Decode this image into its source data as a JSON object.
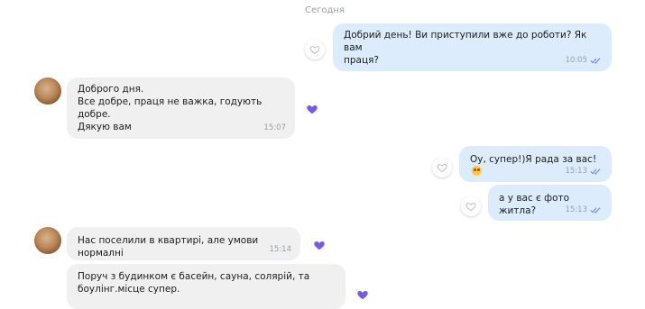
{
  "chat": {
    "date_separator": "Сегодня",
    "messages": [
      {
        "text": "Добрий день! Ви приступили вже до роботи? Як вам\nпраця?",
        "time": "10:05"
      },
      {
        "text": "Доброго дня.\nВсе добре,  праця не важка, годують добре.\nДякую вам",
        "time": "15:07"
      },
      {
        "text": "Оу, супер!)Я рада за вас!",
        "time": "15:13"
      },
      {
        "text": "а у вас є фото житла?",
        "time": "15:13"
      },
      {
        "text": "Нас поселили в квартирі, але умови нормалні",
        "time": "15:14"
      },
      {
        "text": "Поруч з будинком є басейн, сауна, солярій, та\nбоулінг.місце супер.",
        "time": ""
      }
    ]
  },
  "colors": {
    "outgoing_bubble": "#dcecfd",
    "incoming_bubble": "#f0f0f0",
    "liked_heart": "#7b5cd6",
    "read_ticks": "#6b8fd6"
  },
  "icons": {
    "like_empty": "heart-outline-icon",
    "like_filled": "heart-filled-icon",
    "read_receipt": "double-check-icon",
    "emoji": "heart-eyes-emoji"
  }
}
